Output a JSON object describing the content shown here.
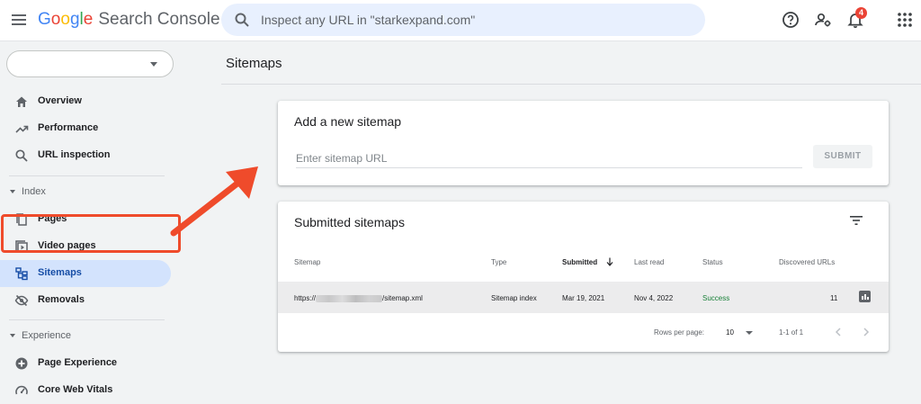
{
  "app": {
    "logo_letters": [
      "G",
      "o",
      "o",
      "g",
      "l",
      "e"
    ],
    "product_name": "Search Console"
  },
  "search": {
    "placeholder": "Inspect any URL in \"starkexpand.com\""
  },
  "topbar": {
    "icons": [
      "help-icon",
      "manage-users-icon",
      "notifications-icon",
      "apps-grid-icon"
    ],
    "notification_count": "4"
  },
  "sidebar": {
    "property_value": "",
    "items": [
      {
        "label": "Overview",
        "icon": "home-icon"
      },
      {
        "label": "Performance",
        "icon": "trending-icon"
      },
      {
        "label": "URL inspection",
        "icon": "search-icon"
      }
    ],
    "sections": [
      {
        "label": "Index",
        "items": [
          {
            "label": "Pages",
            "icon": "pages-icon"
          },
          {
            "label": "Video pages",
            "icon": "video-pages-icon"
          },
          {
            "label": "Sitemaps",
            "icon": "sitemap-icon",
            "active": true
          },
          {
            "label": "Removals",
            "icon": "removals-icon"
          }
        ]
      },
      {
        "label": "Experience",
        "items": [
          {
            "label": "Page Experience",
            "icon": "page-experience-icon"
          },
          {
            "label": "Core Web Vitals",
            "icon": "speed-gauge-icon"
          }
        ]
      }
    ]
  },
  "main": {
    "title": "Sitemaps",
    "add_card": {
      "title": "Add a new sitemap",
      "input_placeholder": "Enter sitemap URL",
      "input_value": "",
      "submit_label": "SUBMIT"
    },
    "submitted_card": {
      "title": "Submitted sitemaps",
      "columns": [
        "Sitemap",
        "Type",
        "Submitted",
        "Last read",
        "Status",
        "Discovered URLs"
      ],
      "sorted_column": "Submitted",
      "rows": [
        {
          "sitemap_prefix": "https://",
          "sitemap_suffix": "/sitemap.xml",
          "type": "Sitemap index",
          "submitted": "Mar 19, 2021",
          "last_read": "Nov 4, 2022",
          "status": "Success",
          "discovered_urls": "11"
        }
      ],
      "footer": {
        "rows_per_page_label": "Rows per page:",
        "rows_per_page_value": "10",
        "range": "1-1 of 1"
      }
    }
  },
  "colors": {
    "accent_blue": "#1a73e8",
    "active_nav_bg": "#d3e3fd",
    "annotation_red": "#ef4b2b",
    "success_green": "#188038",
    "badge_red": "#ea4335"
  }
}
